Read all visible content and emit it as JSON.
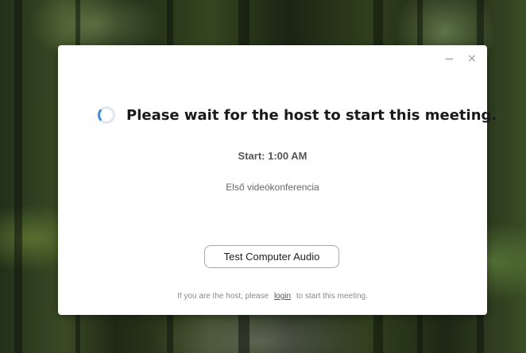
{
  "window": {
    "minimize_glyph": "−",
    "close_glyph": "×"
  },
  "meeting": {
    "status_title": "Please wait for the host to start this meeting.",
    "start_time": "Start: 1:00 AM",
    "topic": "Első videókonferencia"
  },
  "actions": {
    "test_audio_label": "Test Computer Audio"
  },
  "footer": {
    "prefix": "If you are the host, please",
    "login_link": "login",
    "suffix": "to start this meeting."
  },
  "icons": {
    "spinner": "loading-spinner-icon"
  },
  "colors": {
    "spinner_accent": "#3b8de0",
    "dialog_bg": "#ffffff"
  }
}
